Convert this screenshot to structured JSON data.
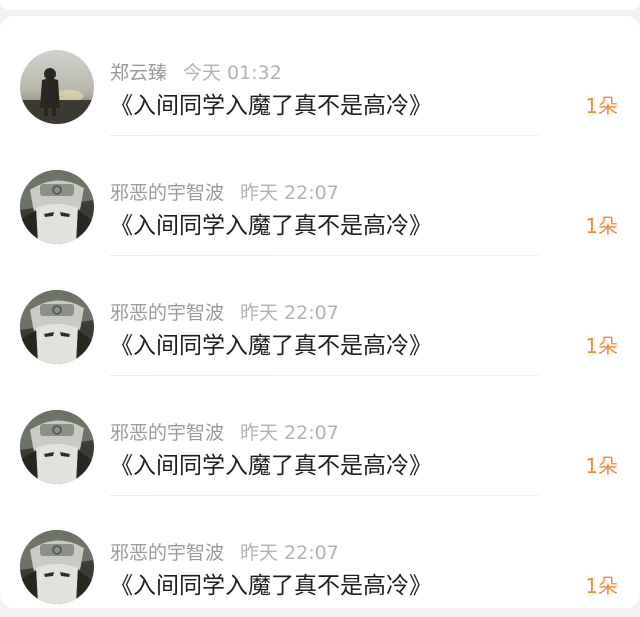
{
  "colors": {
    "background": "#f2f2f2",
    "card": "#ffffff",
    "name_text": "#9a9a9a",
    "title_text": "#1e1e1e",
    "count_accent": "#f08a3b"
  },
  "comments": [
    {
      "avatar": "silhouette-dusk-avatar",
      "name": "郑云臻",
      "time": "今天 01:32",
      "title": "《入间同学入魔了真不是高冷》",
      "count": "1朵"
    },
    {
      "avatar": "anime-ninja-avatar",
      "name": "邪恶的宇智波",
      "time": "昨天 22:07",
      "title": "《入间同学入魔了真不是高冷》",
      "count": "1朵"
    },
    {
      "avatar": "anime-ninja-avatar",
      "name": "邪恶的宇智波",
      "time": "昨天 22:07",
      "title": "《入间同学入魔了真不是高冷》",
      "count": "1朵"
    },
    {
      "avatar": "anime-ninja-avatar",
      "name": "邪恶的宇智波",
      "time": "昨天 22:07",
      "title": "《入间同学入魔了真不是高冷》",
      "count": "1朵"
    },
    {
      "avatar": "anime-ninja-avatar",
      "name": "邪恶的宇智波",
      "time": "昨天 22:07",
      "title": "《入间同学入魔了真不是高冷》",
      "count": "1朵"
    }
  ]
}
